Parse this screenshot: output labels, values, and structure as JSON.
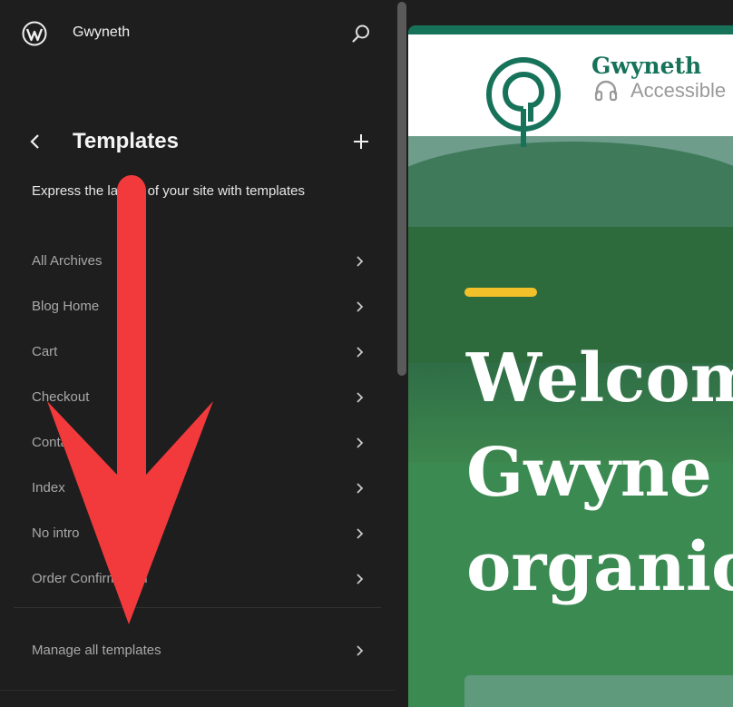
{
  "site": {
    "name": "Gwyneth"
  },
  "panel": {
    "title": "Templates",
    "description": "Express the layout of your site with templates"
  },
  "templates": [
    {
      "label": "All Archives"
    },
    {
      "label": "Blog Home"
    },
    {
      "label": "Cart"
    },
    {
      "label": "Checkout"
    },
    {
      "label": "Contact"
    },
    {
      "label": "Index"
    },
    {
      "label": "No intro"
    },
    {
      "label": "Order Confirmation"
    }
  ],
  "footer_link": {
    "label": "Manage all templates"
  },
  "preview": {
    "brand_name": "Gwyneth",
    "brand_tagline": "Accessible",
    "hero_lines": [
      "Welcom",
      "Gwyne",
      "organic"
    ]
  },
  "colors": {
    "sidebar_bg": "#1e1e1e",
    "brand_green": "#16735a",
    "accent_yellow": "#f2c029",
    "annotation_arrow": "#f23a3c"
  },
  "icons": {
    "logo": "wordpress-icon",
    "search": "search-icon",
    "back": "chevron-left-icon",
    "add": "plus-icon",
    "item": "chevron-right-icon"
  }
}
